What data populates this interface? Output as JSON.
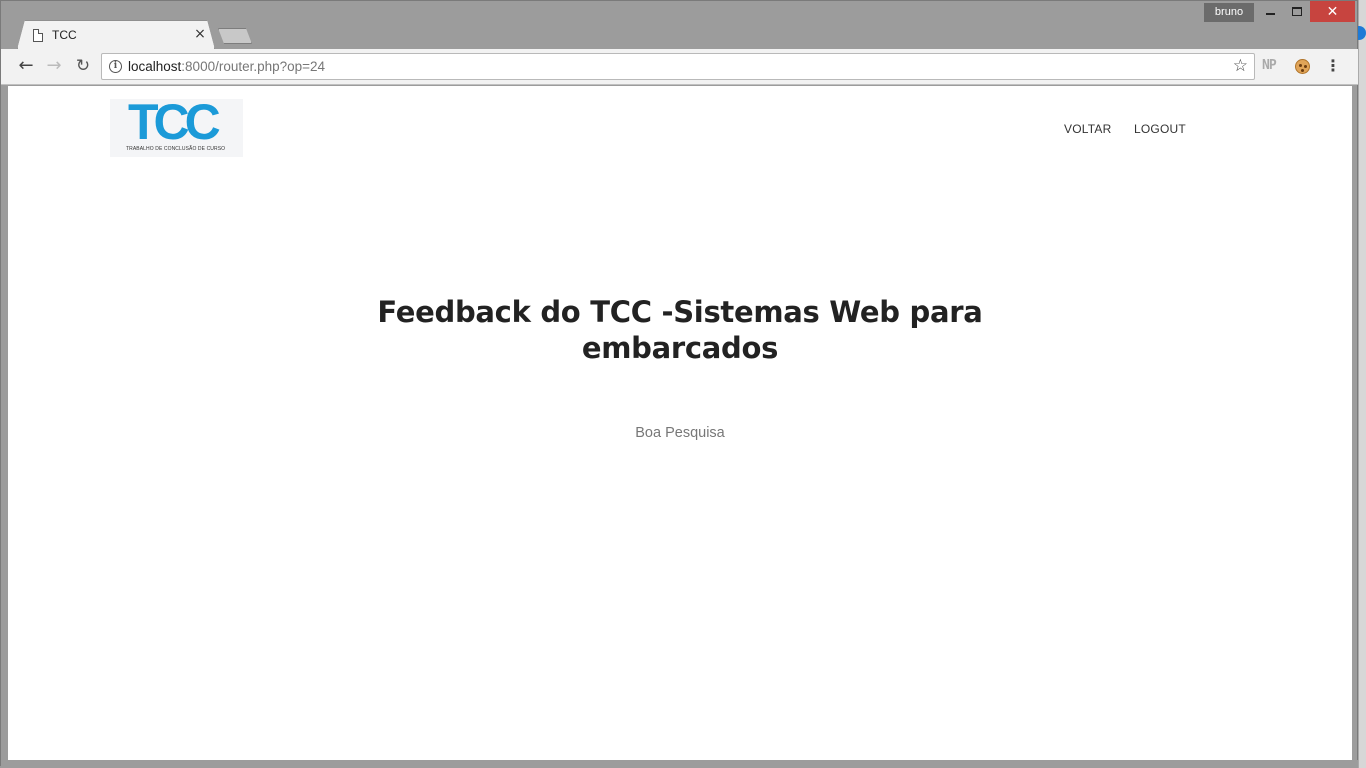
{
  "browser": {
    "tab_title": "TCC",
    "tab_close": "×",
    "profile_name": "bruno",
    "close_symbol": "✕",
    "url_host": "localhost",
    "url_rest": ":8000/router.php?op=24",
    "info_symbol": "i",
    "star_symbol": "☆",
    "ext_np_label": "NP",
    "menu_symbol": "⋮",
    "back_symbol": "←",
    "forward_symbol": "→",
    "reload_symbol": "↻"
  },
  "page": {
    "logo": {
      "text": "TCC",
      "subtitle": "TRABALHO DE CONCLUSÃO DE CURSO",
      "color": "#1b9ad8"
    },
    "nav": {
      "voltar": "VOLTAR",
      "logout": "LOGOUT"
    },
    "headline": "Feedback do TCC -Sistemas Web para embarcados",
    "subtitle": "Boa Pesquisa"
  },
  "icons": {
    "tab": "page-icon",
    "info": "info-icon",
    "star": "star-icon",
    "menu": "menu-icon",
    "cookie_extension": "cookie-icon"
  }
}
